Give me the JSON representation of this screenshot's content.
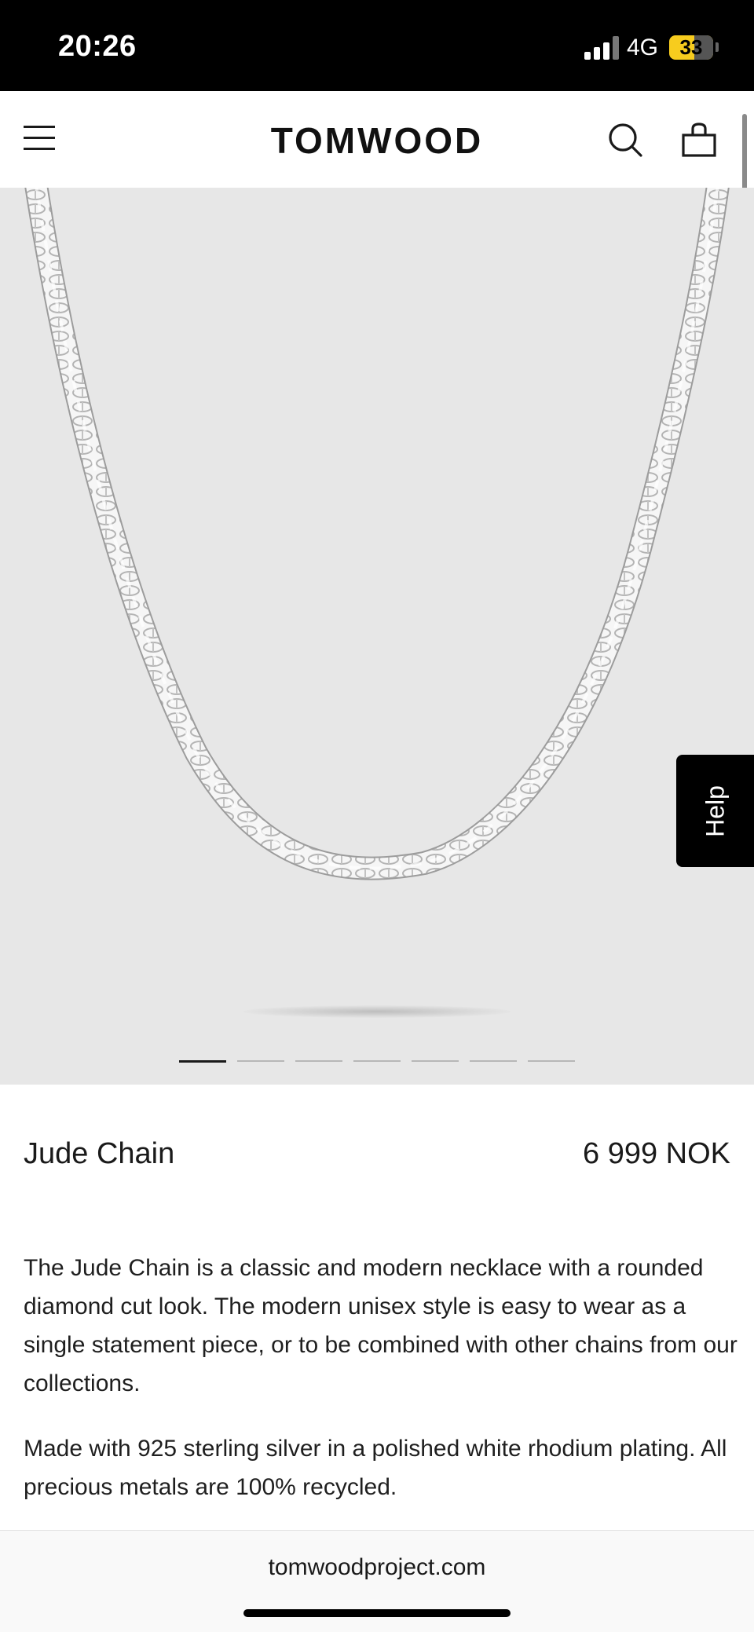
{
  "status_bar": {
    "time": "20:26",
    "network": "4G",
    "battery": "33",
    "icons": [
      "signal-icon",
      "battery-icon"
    ]
  },
  "header": {
    "brand": "TOMWOOD",
    "icons": [
      "menu-icon",
      "search-icon",
      "bag-icon"
    ]
  },
  "gallery": {
    "image_count": 7,
    "active_index": 0,
    "help_label": "Help"
  },
  "product": {
    "name": "Jude Chain",
    "price": "6 999 NOK",
    "description_1": "The Jude Chain is a classic and modern necklace with a rounded diamond cut look. The modern unisex style is easy to wear as a single statement piece, or to be combined with other chains from our collections.",
    "description_2": "Made with 925 sterling silver in a polished white rhodium plating. All precious metals are 100% recycled."
  },
  "browser": {
    "url": "tomwoodproject.com"
  },
  "colors": {
    "hero_background": "#e7e7e7",
    "help_tab": "#000000",
    "battery": "#f7cc1e"
  }
}
